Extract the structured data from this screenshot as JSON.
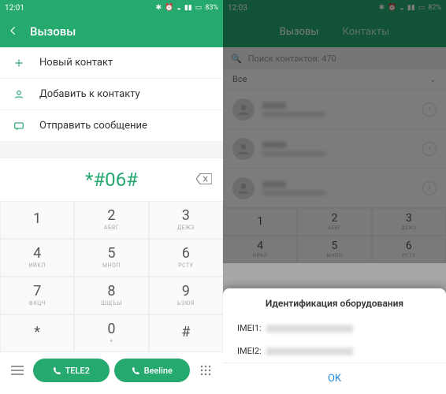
{
  "left": {
    "status": {
      "time": "12:01",
      "battery": "83%"
    },
    "header": {
      "title": "Вызовы"
    },
    "actions": [
      {
        "label": "Новый контакт"
      },
      {
        "label": "Добавить к контакту"
      },
      {
        "label": "Отправить сообщение"
      }
    ],
    "dial": {
      "display": "*#06#"
    },
    "keypad": [
      {
        "d": "1",
        "s": ""
      },
      {
        "d": "2",
        "s": "АБВГ"
      },
      {
        "d": "3",
        "s": "ДЕЖЗ"
      },
      {
        "d": "4",
        "s": "ИЙКЛ"
      },
      {
        "d": "5",
        "s": "МНОП"
      },
      {
        "d": "6",
        "s": "РСТУ"
      },
      {
        "d": "7",
        "s": "ФХЦЧ"
      },
      {
        "d": "8",
        "s": "ШЩЪЫ"
      },
      {
        "d": "9",
        "s": "ЬЭЮЯ"
      },
      {
        "d": "*",
        "s": ""
      },
      {
        "d": "0",
        "s": "+"
      },
      {
        "d": "#",
        "s": ""
      }
    ],
    "call": {
      "sim1": "TELE2",
      "sim2": "Beeline"
    }
  },
  "right": {
    "status": {
      "time": "12:03",
      "battery": "82%"
    },
    "tabs": {
      "a": "Вызовы",
      "b": "Контакты"
    },
    "search": {
      "text": "Поиск контактов: 470"
    },
    "filter": {
      "label": "Все"
    },
    "keypad": [
      {
        "d": "1",
        "s": ""
      },
      {
        "d": "2",
        "s": "АБВГ"
      },
      {
        "d": "3",
        "s": "ДЕЖЗ"
      },
      {
        "d": "4",
        "s": "ИЙКЛ"
      },
      {
        "d": "5",
        "s": "МНОП"
      },
      {
        "d": "6",
        "s": "РСТУ"
      }
    ],
    "dialog": {
      "title": "Идентификация оборудования",
      "row1": "IMEI1:",
      "row2": "IMEI2:",
      "ok": "OK"
    }
  }
}
